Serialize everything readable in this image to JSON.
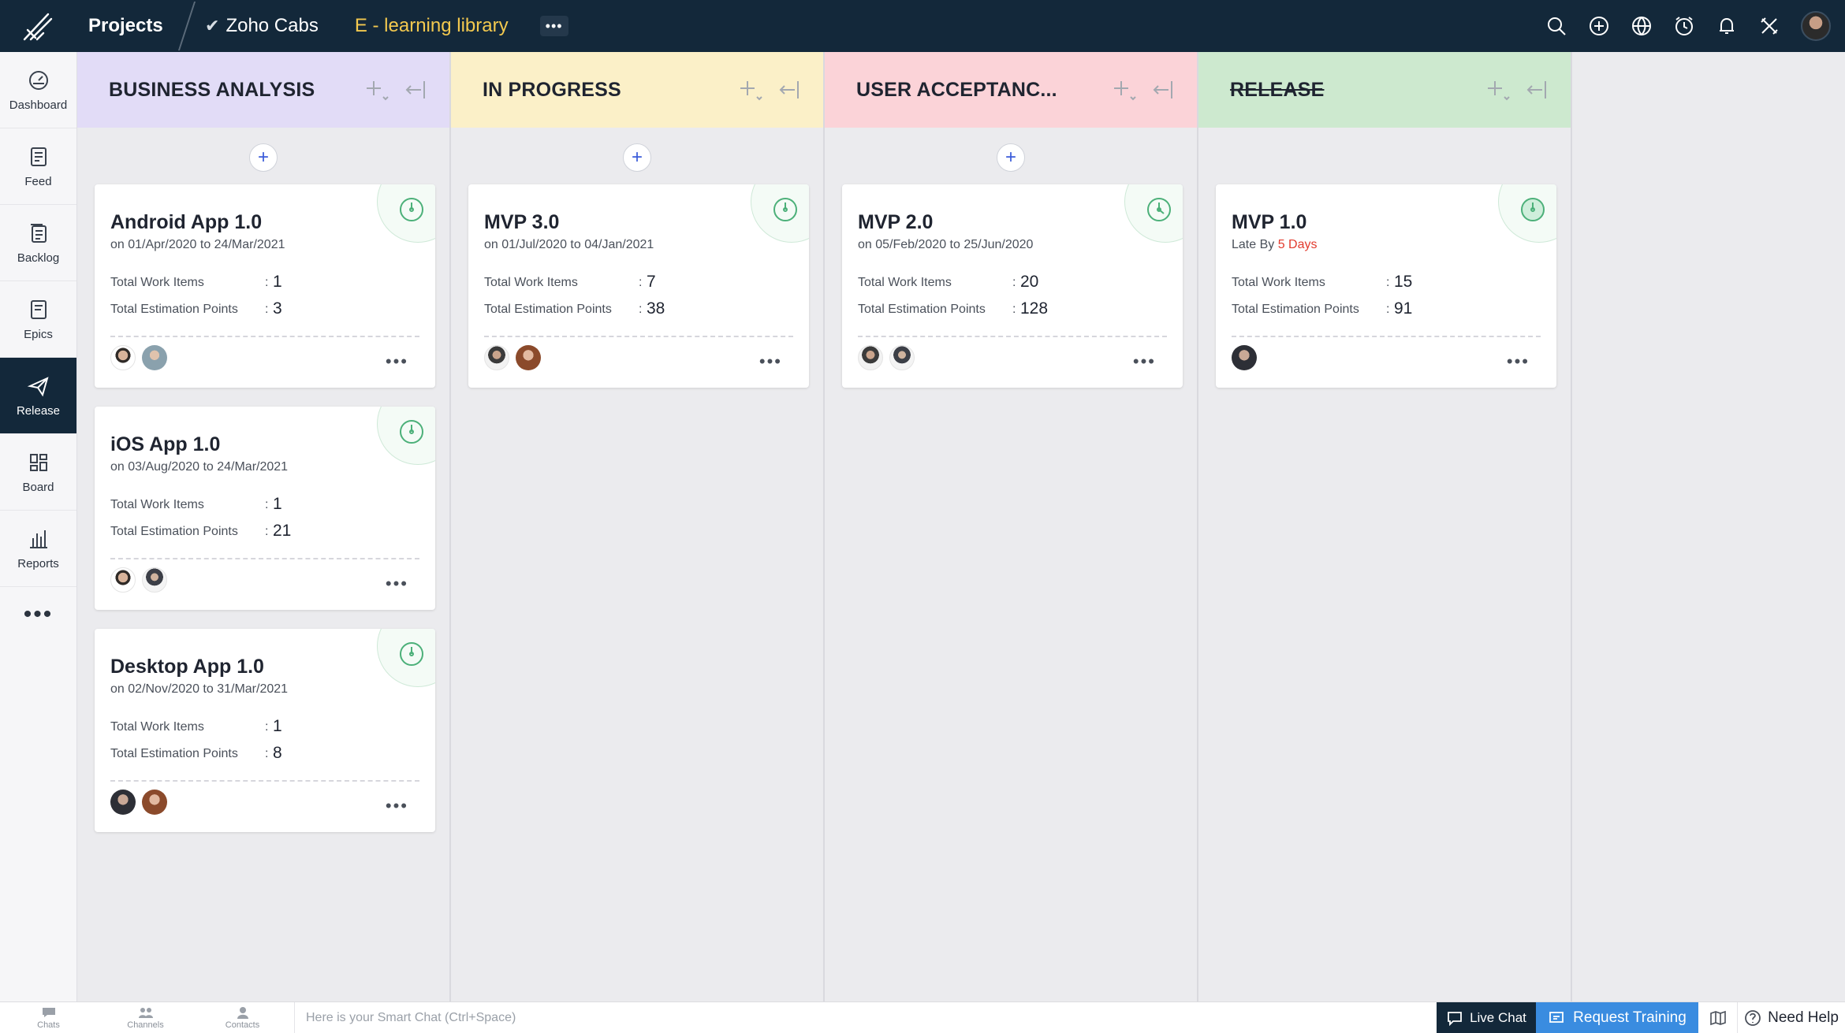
{
  "topbar": {
    "projects_label": "Projects",
    "project_name": "Zoho Cabs",
    "sub_project": "E - learning library",
    "icons": [
      "search-icon",
      "plus-circle-icon",
      "globe-icon",
      "alarm-icon",
      "bell-icon",
      "tools-icon"
    ]
  },
  "nav": {
    "items": [
      {
        "label": "Dashboard",
        "icon": "dashboard-icon"
      },
      {
        "label": "Feed",
        "icon": "feed-icon"
      },
      {
        "label": "Backlog",
        "icon": "backlog-icon"
      },
      {
        "label": "Epics",
        "icon": "epics-icon"
      },
      {
        "label": "Release",
        "icon": "paper-plane-icon",
        "active": true
      },
      {
        "label": "Board",
        "icon": "board-icon"
      },
      {
        "label": "Reports",
        "icon": "reports-icon"
      }
    ]
  },
  "labels": {
    "work_items": "Total Work Items",
    "estimation": "Total Estimation Points",
    "colon": ":",
    "more": "•••",
    "plus": "+"
  },
  "columns": [
    {
      "title": "BUSINESS ANALYSIS",
      "color": "#e2dcf7",
      "cards": [
        {
          "title": "Android App 1.0",
          "date": "on 01/Apr/2020 to 24/Mar/2021",
          "work_items": "1",
          "points": "3"
        },
        {
          "title": "iOS App 1.0",
          "date": "on 03/Aug/2020 to 24/Mar/2021",
          "work_items": "1",
          "points": "21"
        },
        {
          "title": "Desktop App 1.0",
          "date": "on 02/Nov/2020 to 31/Mar/2021",
          "work_items": "1",
          "points": "8"
        }
      ]
    },
    {
      "title": "IN PROGRESS",
      "color": "#fbf0c8",
      "cards": [
        {
          "title": "MVP 3.0",
          "date": "on 01/Jul/2020 to 04/Jan/2021",
          "work_items": "7",
          "points": "38"
        }
      ]
    },
    {
      "title": "USER ACCEPTANC...",
      "color": "#fbd3d8",
      "cards": [
        {
          "title": "MVP 2.0",
          "date": "on 05/Feb/2020 to 25/Jun/2020",
          "work_items": "20",
          "points": "128"
        }
      ]
    },
    {
      "title": "RELEASE",
      "color": "#cde9cf",
      "cards": [
        {
          "title": "MVP 1.0",
          "late_prefix": "Late By ",
          "late_value": "5 Days",
          "work_items": "15",
          "points": "91"
        }
      ]
    }
  ],
  "bottombar": {
    "chats": "Chats",
    "channels": "Channels",
    "contacts": "Contacts",
    "smartchat_placeholder": "Here is your Smart Chat (Ctrl+Space)",
    "live_chat": "Live Chat",
    "request_training": "Request Training",
    "need_help": "Need Help"
  }
}
